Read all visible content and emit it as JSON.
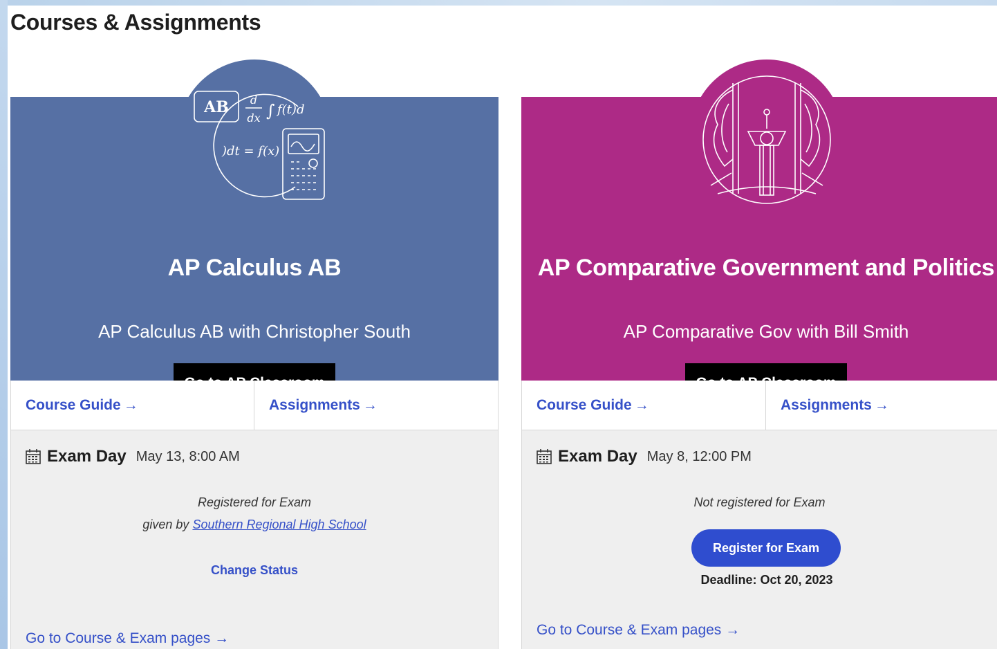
{
  "page": {
    "title": "Courses & Assignments"
  },
  "colors": {
    "calculus": "#5670a4",
    "government": "#ad2a86",
    "link": "#3550c8",
    "register_button": "#2f4dcf"
  },
  "courses": [
    {
      "illustration": "calculus-formula-calculator-icon",
      "illustration_text": {
        "ab": "AB",
        "d": "d",
        "dx": "dx",
        "int1": "∫",
        "fx1": "f(t)d",
        "fx2": ")dt = f(x)"
      },
      "title": "AP Calculus AB",
      "section": "AP Calculus AB with Christopher South",
      "classroom_button": "Go to AP Classroom",
      "course_guide": "Course Guide",
      "assignments": "Assignments",
      "exam_label": "Exam Day",
      "exam_date": "May 13, 8:00 AM",
      "status": "Registered for Exam",
      "given_by_prefix": "given by",
      "school": "Southern Regional High School",
      "change_status": "Change Status",
      "exam_pages": "Go to Course & Exam pages"
    },
    {
      "illustration": "government-podium-flags-icon",
      "title": "AP Comparative Government and Politics",
      "section": "AP Comparative Gov with Bill Smith",
      "classroom_button": "Go to AP Classroom",
      "course_guide": "Course Guide",
      "assignments": "Assignments",
      "exam_label": "Exam Day",
      "exam_date": "May 8, 12:00 PM",
      "status": "Not registered for Exam",
      "register_button": "Register for Exam",
      "deadline": "Deadline: Oct 20, 2023",
      "exam_pages": "Go to Course & Exam pages"
    }
  ]
}
